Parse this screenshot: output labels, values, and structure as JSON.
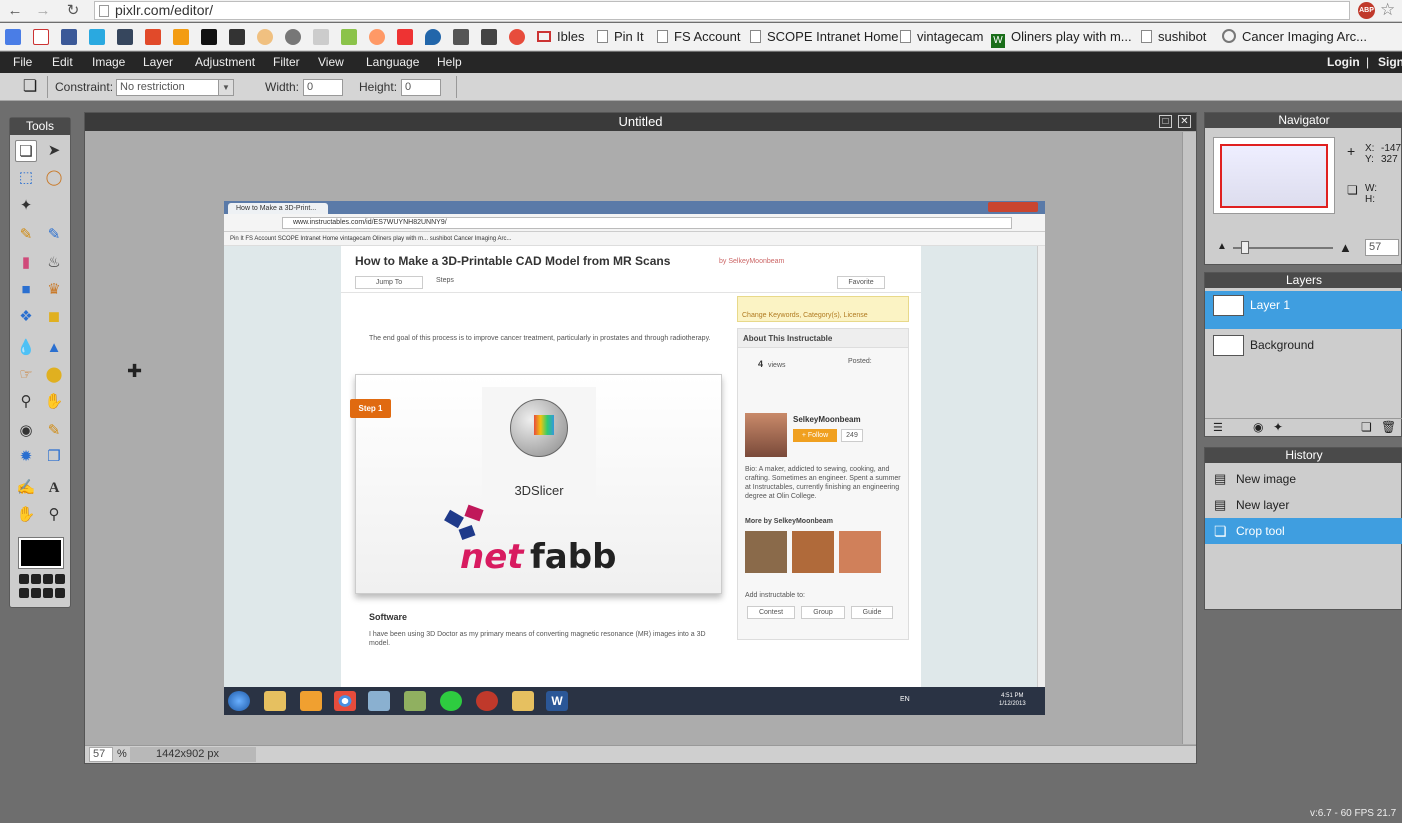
{
  "browser": {
    "url": "pixlr.com/editor/",
    "bookmarks": [
      "Ibles",
      "Pin It",
      "FS Account",
      "SCOPE Intranet Home",
      "vintagecam",
      "Oliners play with m...",
      "sushibot",
      "Cancer Imaging Arc..."
    ],
    "abp_label": "ABP"
  },
  "menu": {
    "items": [
      "File",
      "Edit",
      "Image",
      "Layer",
      "Adjustment",
      "Filter",
      "View",
      "Language",
      "Help"
    ],
    "login": "Login",
    "sep": "|",
    "signup": "Sign"
  },
  "options": {
    "constraint_label": "Constraint:",
    "constraint_value": "No restriction",
    "width_label": "Width:",
    "width_value": "0",
    "height_label": "Height:",
    "height_value": "0"
  },
  "tools": {
    "title": "Tools"
  },
  "document": {
    "title": "Untitled",
    "zoom": "57",
    "zoom_unit": "%",
    "dimensions": "1442x902 px"
  },
  "screenshot": {
    "tab_title": "How to Make a 3D-Print...",
    "url": "www.instructables.com/id/ES7WUYNH82UNNY9/",
    "bookmarks_text": "Pin It   FS Account   SCOPE Intranet Home   vintagecam   Oliners play with m...   sushibot   Cancer Imaging Arc...",
    "title": "How to Make a 3D-Printable CAD Model from MR Scans",
    "author": "by SelkeyMoonbeam",
    "jump_to": "Jump To",
    "steps": "Steps",
    "favorite": "Favorite",
    "para1": "The end goal of this process is to improve cancer treatment, particularly in prostates and through radiotherapy.",
    "step_label": "Step 1",
    "slicer": "3DSlicer",
    "netfabb_net": "net",
    "netfabb_fabb": "fabb",
    "software_heading": "Software",
    "software_text": "I have been using 3D Doctor as my primary means of converting magnetic resonance (MR) images into a 3D model.",
    "about_heading": "About This Instructable",
    "views": "4",
    "views_label": "views",
    "posted": "Posted:",
    "user": "SelkeyMoonbeam",
    "follow": "+ Follow",
    "followers": "249",
    "bio": "Bio: A maker, addicted to sewing, cooking, and crafting. Sometimes an engineer. Spent a summer at Instructables, currently finishing an engineering degree at Olin College.",
    "more_by": "More by SelkeyMoonbeam",
    "add_to": "Add instructable to:",
    "btn_contest": "Contest",
    "btn_group": "Group",
    "btn_guide": "Guide",
    "keywords": "Change Keywords, Category(s), License",
    "clock_time": "4:51 PM",
    "clock_date": "1/12/2013",
    "lang": "EN"
  },
  "navigator": {
    "title": "Navigator",
    "x_label": "X:",
    "x_value": "-147",
    "y_label": "Y:",
    "y_value": "327",
    "w_label": "W:",
    "h_label": "H:",
    "zoom": "57"
  },
  "layers": {
    "title": "Layers",
    "items": [
      "Layer 1",
      "Background"
    ]
  },
  "history": {
    "title": "History",
    "items": [
      "New image",
      "New layer",
      "Crop tool"
    ]
  },
  "footer": {
    "version": "v:6.7 - 60 FPS 21.7"
  },
  "colors": {
    "accent": "#3f9ee0",
    "menubar": "#262626",
    "panel": "#cdcdcd"
  },
  "icons": [
    "crop-icon",
    "move-icon",
    "marquee-icon",
    "lasso-icon",
    "wand-icon",
    "pencil-icon",
    "brush-icon",
    "eraser-icon",
    "bucket-icon",
    "gradient-icon",
    "stamp-icon",
    "colorreplace-icon",
    "shapes-icon",
    "drop-icon",
    "sharpen-icon",
    "smudge-icon",
    "sponge-icon",
    "burn-icon",
    "dodge-icon",
    "redeye-icon",
    "spotheal-icon",
    "bloat-icon",
    "pinch-icon",
    "picker-icon",
    "type-icon",
    "hand-icon",
    "zoom-icon"
  ]
}
